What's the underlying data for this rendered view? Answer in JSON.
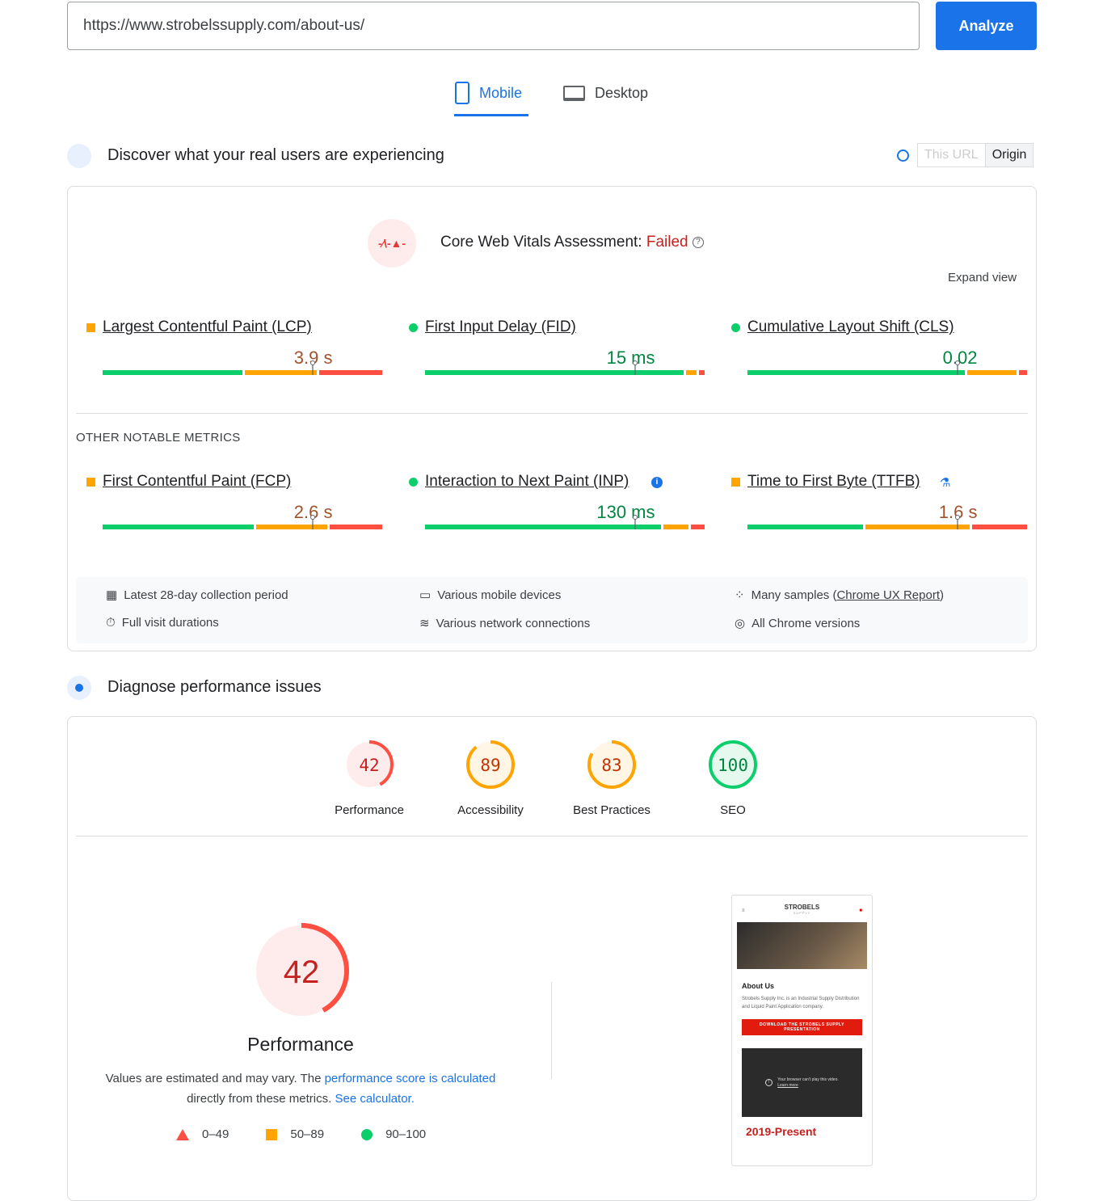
{
  "search": {
    "url": "https://www.strobelssupply.com/about-us/",
    "analyze_label": "Analyze"
  },
  "tabs": [
    {
      "label": "Mobile",
      "active": true
    },
    {
      "label": "Desktop",
      "active": false
    }
  ],
  "field": {
    "title": "Discover what your real users are experiencing",
    "toggle": [
      "This URL",
      "Origin"
    ],
    "selected": "Origin",
    "assessment_label": "Core Web Vitals Assessment:",
    "assessment_status": "Failed",
    "expand": "Expand view",
    "other_label": "OTHER NOTABLE METRICS",
    "core": [
      {
        "name": "Largest Contentful Paint (LCP)",
        "value": "3.9 s",
        "rating": "average",
        "dist": [
          51,
          26,
          23
        ],
        "p75": 0.75
      },
      {
        "name": "First Input Delay (FID)",
        "value": "15 ms",
        "rating": "good",
        "dist": [
          94,
          4,
          2
        ],
        "p75": 0.75
      },
      {
        "name": "Cumulative Layout Shift (CLS)",
        "value": "0.02",
        "rating": "good",
        "dist": [
          79,
          18,
          3
        ],
        "p75": 0.75
      }
    ],
    "other": [
      {
        "name": "First Contentful Paint (FCP)",
        "value": "2.6 s",
        "rating": "average",
        "dist": [
          55,
          26,
          19
        ],
        "p75": 0.75
      },
      {
        "name": "Interaction to Next Paint (INP)",
        "value": "130 ms",
        "rating": "good",
        "dist": [
          86,
          9,
          5
        ],
        "p75": 0.75
      },
      {
        "name": "Time to First Byte (TTFB)",
        "value": "1.6 s",
        "rating": "average",
        "dist": [
          42,
          38,
          20
        ],
        "p75": 0.75
      }
    ],
    "info": [
      "Latest 28-day collection period",
      "Various mobile devices",
      "Many samples (",
      "Chrome UX Report",
      ")",
      "Full visit durations",
      "Various network connections",
      "All Chrome versions"
    ]
  },
  "lab": {
    "title": "Diagnose performance issues",
    "scores": [
      {
        "label": "Performance",
        "value": 42
      },
      {
        "label": "Accessibility",
        "value": 89
      },
      {
        "label": "Best Practices",
        "value": 83
      },
      {
        "label": "SEO",
        "value": 100
      }
    ],
    "big_label": "Performance",
    "note1": "Values are estimated and may vary. The ",
    "note_link1": "performance score is calculated",
    "note2": "directly from these metrics. ",
    "note_link2": "See calculator.",
    "legend": [
      "0–49",
      "50–89",
      "90–100"
    ]
  },
  "thumb": {
    "logo": "STROBELS",
    "logo_sub": "SUPPLY",
    "heading": "About Us",
    "text": "Strobels Supply Inc. is an Industrial Supply Distribution and Liquid Paint Application company.",
    "button": "DOWNLOAD THE STROBELS SUPPLY PRESENTATION",
    "video": "Your browser can't play this video.",
    "video_link": "Learn more",
    "year": "2019-Present"
  },
  "colors": {
    "good": "#0cce6b",
    "average": "#ffa400",
    "poor": "#ff4e42",
    "accent": "#1a73e8",
    "good_text": "#018642",
    "average_text": "#a0522d",
    "poor_text": "#c5221f"
  }
}
